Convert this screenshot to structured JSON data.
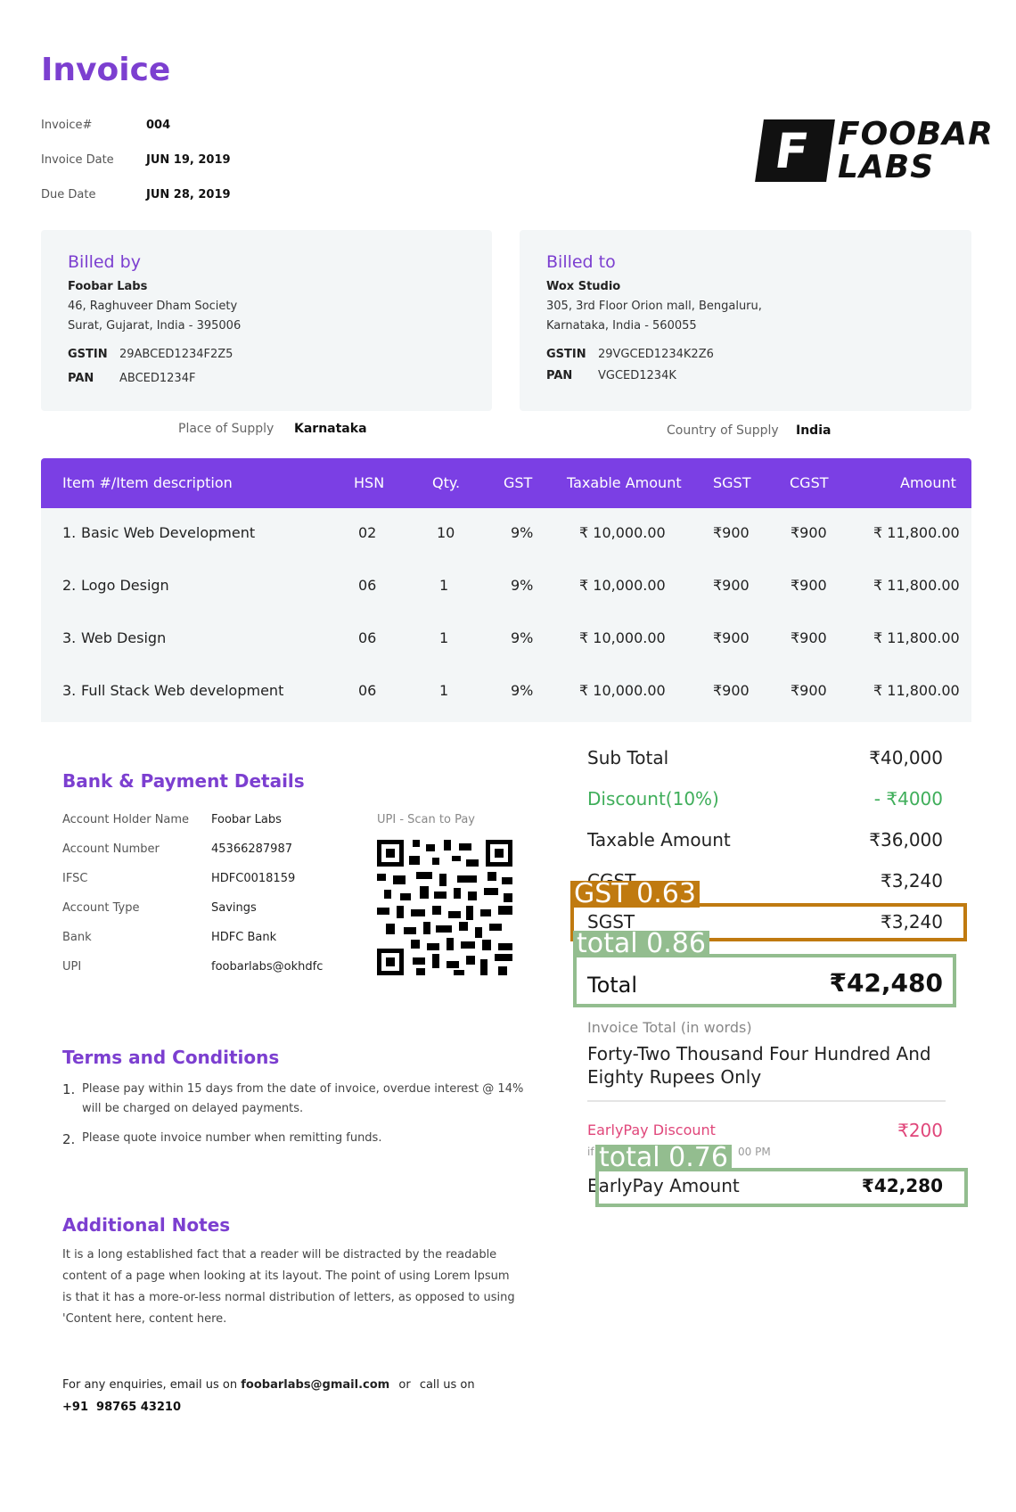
{
  "header": {
    "title": "Invoice",
    "invoice_no_label": "Invoice#",
    "invoice_no": "004",
    "invoice_date_label": "Invoice Date",
    "invoice_date": "JUN 19, 2019",
    "due_date_label": "Due Date",
    "due_date": "JUN 28, 2019",
    "logo_line1": "FOOBAR",
    "logo_line2": "LABS",
    "logo_mark": "F"
  },
  "billed_by": {
    "title": "Billed by",
    "name": "Foobar Labs",
    "address1": "46, Raghuveer Dham Society",
    "address2": "Surat, Gujarat, India - 395006",
    "gstin_label": "GSTIN",
    "gstin": "29ABCED1234F2Z5",
    "pan_label": "PAN",
    "pan": "ABCED1234F"
  },
  "billed_to": {
    "title": "Billed to",
    "name": "Wox Studio",
    "address1": "305, 3rd Floor Orion mall, Bengaluru,",
    "address2": "Karnataka, India - 560055",
    "gstin_label": "GSTIN",
    "gstin": "29VGCED1234K2Z6",
    "pan_label": "PAN",
    "pan": "VGCED1234K"
  },
  "supply": {
    "place_label": "Place of Supply",
    "place": "Karnataka",
    "country_label": "Country of Supply",
    "country": "India"
  },
  "table": {
    "headers": [
      "Item #/Item description",
      "HSN",
      "Qty.",
      "GST",
      "Taxable Amount",
      "SGST",
      "CGST",
      "Amount"
    ],
    "rows": [
      {
        "num": "1.",
        "desc": "Basic Web Development",
        "hsn": "02",
        "qty": "10",
        "gst": "9%",
        "taxable": "₹ 10,000.00",
        "sgst": "₹900",
        "cgst": "₹900",
        "amount": "₹ 11,800.00"
      },
      {
        "num": "2.",
        "desc": "Logo Design",
        "hsn": "06",
        "qty": "1",
        "gst": "9%",
        "taxable": "₹ 10,000.00",
        "sgst": "₹900",
        "cgst": "₹900",
        "amount": "₹ 11,800.00"
      },
      {
        "num": "3.",
        "desc": "Web Design",
        "hsn": "06",
        "qty": "1",
        "gst": "9%",
        "taxable": "₹ 10,000.00",
        "sgst": "₹900",
        "cgst": "₹900",
        "amount": "₹ 11,800.00"
      },
      {
        "num": "3.",
        "desc": "Full Stack Web development",
        "hsn": "06",
        "qty": "1",
        "gst": "9%",
        "taxable": "₹ 10,000.00",
        "sgst": "₹900",
        "cgst": "₹900",
        "amount": "₹ 11,800.00"
      }
    ]
  },
  "bank": {
    "title": "Bank & Payment Details",
    "rows": [
      {
        "label": "Account Holder Name",
        "value": "Foobar Labs"
      },
      {
        "label": "Account Number",
        "value": "45366287987"
      },
      {
        "label": "IFSC",
        "value": "HDFC0018159"
      },
      {
        "label": "Account Type",
        "value": "Savings"
      },
      {
        "label": "Bank",
        "value": "HDFC Bank"
      },
      {
        "label": "UPI",
        "value": "foobarlabs@okhdfc"
      }
    ],
    "upi_label": "UPI - Scan to Pay"
  },
  "summary": {
    "subtotal_label": "Sub Total",
    "subtotal": "₹40,000",
    "discount_label": "Discount(10%)",
    "discount": "- ₹4000",
    "taxable_label": "Taxable Amount",
    "taxable": "₹36,000",
    "cgst_label": "CGST",
    "cgst": "₹3,240",
    "sgst_label": "SGST",
    "sgst": "₹3,240",
    "total_label": "Total",
    "total": "₹42,480",
    "words_label": "Invoice Total (in words)",
    "words_line1": "Forty-Two Thousand Four Hundred And",
    "words_line2": "Eighty Rupees Only",
    "earlypay_label": "EarlyPay Discount",
    "earlypay": "₹200",
    "earlypay_note_left": "if",
    "earlypay_note_right": "00 PM",
    "earlypay_amount_label": "EarlyPay Amount",
    "earlypay_amount": "₹42,280"
  },
  "detections": [
    {
      "label": "GST 0.63",
      "color": "#c07a10"
    },
    {
      "label": "total 0.86",
      "color": "#93bd8f"
    },
    {
      "label": "total 0.76",
      "color": "#93bd8f"
    }
  ],
  "terms": {
    "title": "Terms and Conditions",
    "items": [
      {
        "num": "1.",
        "line1": "Please pay within 15 days from the date of invoice, overdue interest @ 14%",
        "line2": "will be charged on delayed payments."
      },
      {
        "num": "2.",
        "line1": "Please quote invoice number when remitting funds.",
        "line2": ""
      }
    ]
  },
  "notes": {
    "title": "Additional Notes",
    "lines": [
      "It is a long established fact that a reader will be distracted by the readable",
      "content of a page when looking at its layout. The point of using Lorem Ipsum",
      "is that it has a more-or-less normal distribution of letters, as opposed to using",
      "'Content here, content here."
    ]
  },
  "footer": {
    "text1": "For any enquiries, email us on",
    "email": "foobarlabs@gmail.com",
    "text2": "or",
    "text3": "call us on",
    "phone": "+91  98765 43210"
  }
}
